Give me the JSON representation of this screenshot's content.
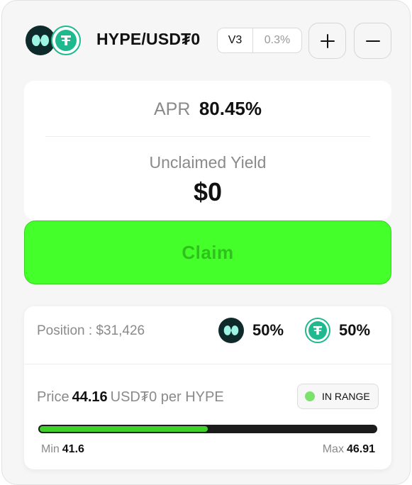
{
  "header": {
    "pair": "HYPE/USD₮0",
    "version": "V3",
    "fee": "0.3%",
    "tokens": [
      {
        "name": "HYPE",
        "icon": "hype-token-icon",
        "color": "#0f2a2a"
      },
      {
        "name": "USD₮0",
        "icon": "usdt0-token-icon",
        "color": "#1fb98f"
      }
    ],
    "actions": [
      {
        "icon": "plus-icon",
        "glyph": "+"
      },
      {
        "icon": "minus-icon",
        "glyph": "−"
      }
    ]
  },
  "apr": {
    "label": "APR",
    "value": "80.45%"
  },
  "yield": {
    "label": "Unclaimed Yield",
    "value": "$0"
  },
  "claim": {
    "label": "Claim",
    "color": "#44ff29"
  },
  "position": {
    "label": "Position : $31,426",
    "allocation": [
      {
        "token": "HYPE",
        "icon": "hype-token-icon",
        "percent": "50%"
      },
      {
        "token": "USD₮0",
        "icon": "usdt0-token-icon",
        "percent": "50%"
      }
    ],
    "price": {
      "label": "Price",
      "value": "44.16",
      "unit": "USD₮0 per HYPE"
    },
    "status": "IN RANGE",
    "status_color": "#7be36b",
    "range": {
      "min_label": "Min",
      "min": "41.6",
      "max_label": "Max",
      "max": "46.91",
      "fill_fraction": 0.5
    }
  }
}
